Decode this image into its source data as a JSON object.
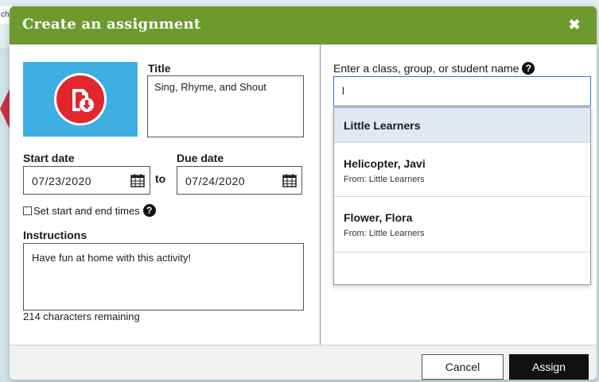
{
  "background": {
    "snippet_text": "che"
  },
  "dialog": {
    "title": "Create an assignment",
    "close_label": "✖",
    "header_color": "#6c9a2c"
  },
  "left": {
    "thumbnail_icon": "download-document-icon",
    "title_label": "Title",
    "title_value": "Sing, Rhyme, and Shout",
    "start_date_label": "Start date",
    "start_date_value": "07/23/2020",
    "to_label": "to",
    "due_date_label": "Due date",
    "due_date_value": "07/24/2020",
    "set_times_label": "Set start and end times",
    "set_times_checked": false,
    "instructions_label": "Instructions",
    "instructions_value": "Have fun at home with this activity!",
    "chars_remaining": "214 characters remaining"
  },
  "right": {
    "search_label": "Enter a class, group, or student name",
    "help_glyph": "?",
    "search_value": "l",
    "results": [
      {
        "name": "Little Learners",
        "from": ""
      },
      {
        "name": "Helicopter, Javi",
        "from": "From: Little Learners"
      },
      {
        "name": "Flower, Flora",
        "from": "From: Little Learners"
      }
    ]
  },
  "footer": {
    "cancel_label": "Cancel",
    "assign_label": "Assign"
  }
}
